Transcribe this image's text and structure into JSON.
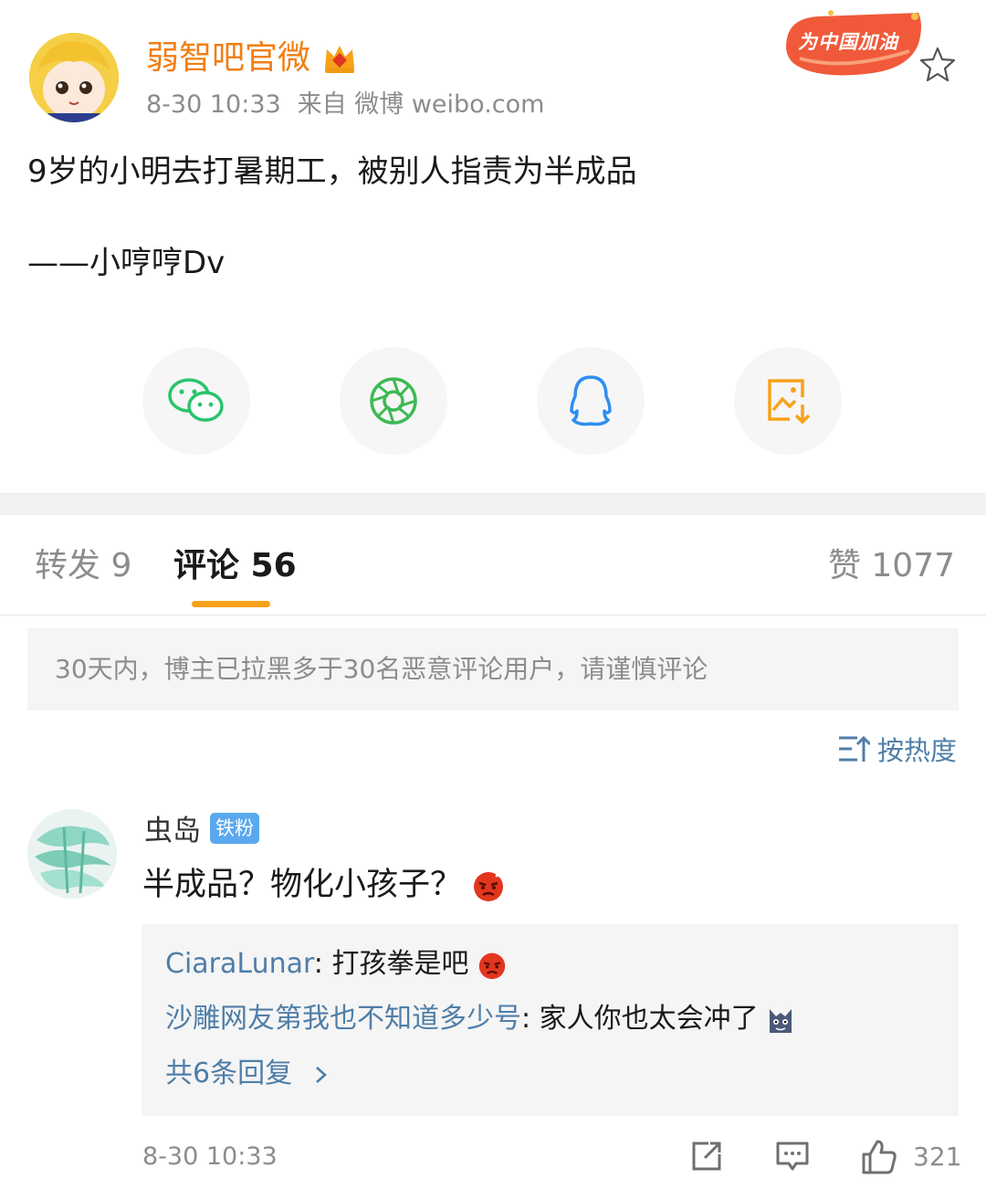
{
  "post": {
    "author": "弱智吧官微",
    "time": "8-30 10:33",
    "source": "来自 微博 weibo.com",
    "badge": "为中国加油",
    "text": "9岁的小明去打暑期工，被别人指责为半成品",
    "signature": "——小哼哼Dv"
  },
  "share": {
    "icons": [
      "wechat-icon",
      "moments-icon",
      "qq-icon",
      "save-image-icon"
    ],
    "colors": {
      "wechat": "#2ac46b",
      "moments": "#3dba55",
      "qq": "#2f8ef0",
      "save": "#f7a21b"
    }
  },
  "tabs": {
    "repost": "转发 9",
    "comment": "评论 56",
    "likes": "赞 1077"
  },
  "notice": "30天内，博主已拉黑多于30名恶意评论用户，请谨慎评论",
  "sort_label": "按热度",
  "comment": {
    "user": "虫岛",
    "tag": "铁粉",
    "text": "半成品？物化小孩子？",
    "replies": [
      {
        "user": "CiaraLunar",
        "sep": ": ",
        "text": "打孩拳是吧"
      },
      {
        "user": "沙雕网友第我也不知道多少号",
        "sep": ": ",
        "text": "家人你也太会冲了"
      }
    ],
    "more_replies": "共6条回复",
    "time": "8-30 10:33",
    "likes": "321"
  },
  "colors": {
    "brand_orange": "#f27e14",
    "link_blue": "#4f7ea8",
    "tab_accent": "#f7a21b",
    "tag_blue": "#5aa9ee"
  }
}
